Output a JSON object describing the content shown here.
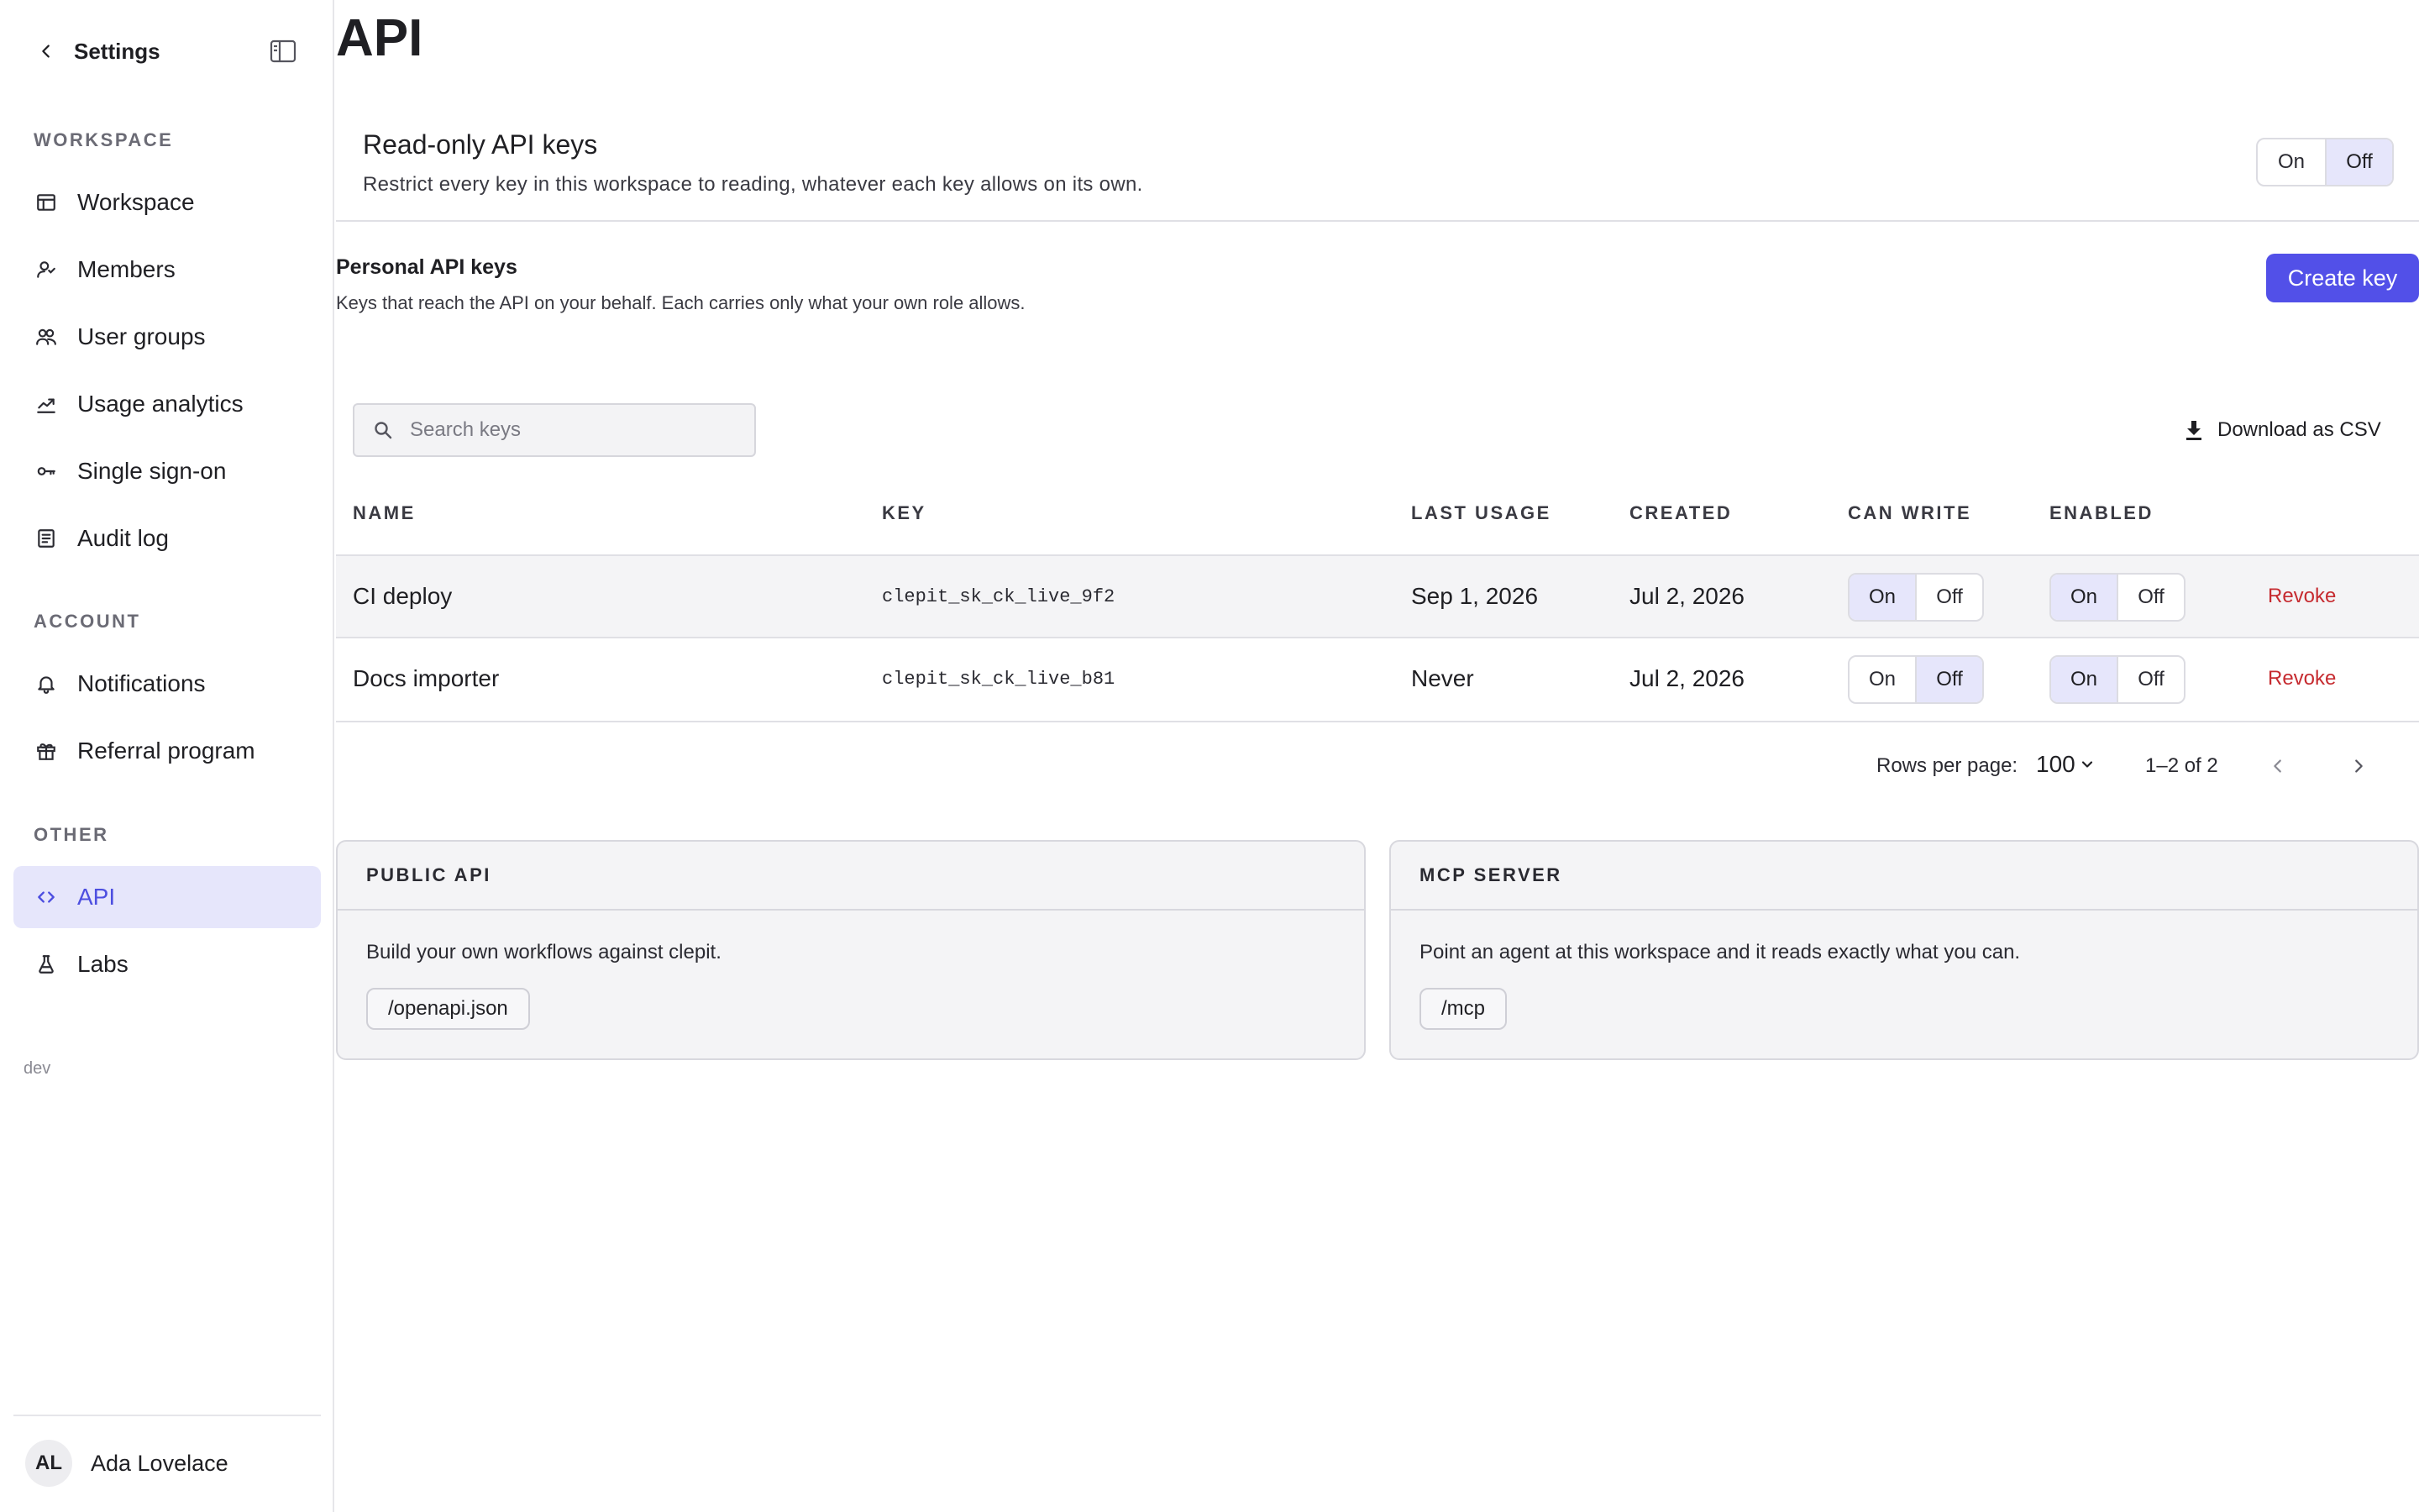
{
  "sidebar": {
    "title": "Settings",
    "sections": {
      "workspace": "WORKSPACE",
      "account": "ACCOUNT",
      "other": "OTHER"
    },
    "items": {
      "workspace": "Workspace",
      "members": "Members",
      "user_groups": "User groups",
      "usage_analytics": "Usage analytics",
      "single_sign_on": "Single sign-on",
      "audit_log": "Audit log",
      "notifications": "Notifications",
      "referral_program": "Referral program",
      "api": "API",
      "labs": "Labs"
    },
    "active_item": "API",
    "env": "dev",
    "user": {
      "initials": "AL",
      "name": "Ada Lovelace"
    }
  },
  "page": {
    "title": "API"
  },
  "readonly": {
    "title": "Read-only API keys",
    "description": "Restrict every key in this workspace to reading, whatever each key allows on its own.",
    "on_label": "On",
    "off_label": "Off",
    "selected": "Off"
  },
  "personal_keys": {
    "title": "Personal API keys",
    "description": "Keys that reach the API on your behalf. Each carries only what your own role allows.",
    "create_label": "Create key"
  },
  "search": {
    "placeholder": "Search keys",
    "value": ""
  },
  "download_label": "Download as CSV",
  "table": {
    "headers": {
      "name": "NAME",
      "key": "KEY",
      "last_usage": "LAST USAGE",
      "created": "CREATED",
      "can_write": "CAN WRITE",
      "enabled": "ENABLED"
    },
    "rows": [
      {
        "name": "CI deploy",
        "key": "clepit_sk_ck_live_9f2",
        "last_usage": "Sep 1, 2026",
        "created": "Jul 2, 2026",
        "can_write": {
          "on": "On",
          "off": "Off",
          "selected": "On"
        },
        "enabled": {
          "on": "On",
          "off": "Off",
          "selected": "On"
        },
        "action": "Revoke"
      },
      {
        "name": "Docs importer",
        "key": "clepit_sk_ck_live_b81",
        "last_usage": "Never",
        "created": "Jul 2, 2026",
        "can_write": {
          "on": "On",
          "off": "Off",
          "selected": "Off"
        },
        "enabled": {
          "on": "On",
          "off": "Off",
          "selected": "On"
        },
        "action": "Revoke"
      }
    ]
  },
  "pagination": {
    "rows_per_page_label": "Rows per page:",
    "rows_per_page": "100",
    "range": "1–2 of 2"
  },
  "cards": {
    "public_api": {
      "title": "PUBLIC API",
      "text": "Build your own workflows against clepit.",
      "chip": "/openapi.json"
    },
    "mcp_server": {
      "title": "MCP SERVER",
      "text": "Point an agent at this workspace and it reads exactly what you can.",
      "chip": "/mcp"
    }
  },
  "colors": {
    "accent": "#5250e8",
    "active_bg": "#e6e6fb",
    "danger": "#c62b30"
  }
}
